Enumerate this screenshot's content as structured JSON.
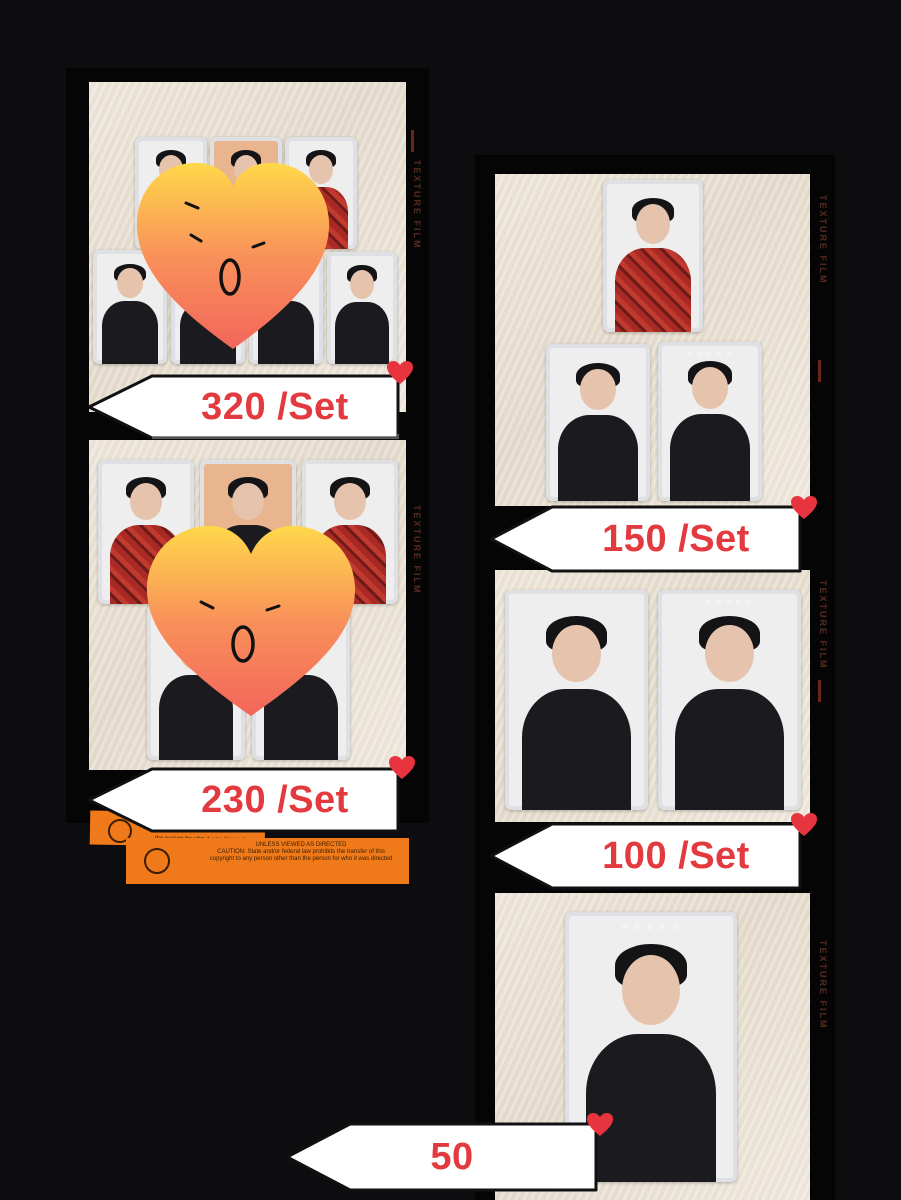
{
  "prices": {
    "set_a": "320 /Set",
    "set_b": "230 /Set",
    "set_c": "150 /Set",
    "set_d": "100 /Set",
    "single": "50"
  },
  "film_edge": {
    "brand": "TEXTURE FILM"
  },
  "sticker": {
    "line1": "the person for who it was directed",
    "line2": "UNLESS VIEWED AS DIRECTED",
    "line3": "CAUTION: State and/or federal law prohibits the transfer of this copyright to any person other than the person for who it was directed"
  },
  "icons": [
    "heart-sticker-icon",
    "small-heart-icon",
    "arrow-tag-icon",
    "smiley-icon"
  ],
  "colors": {
    "background": "#0d0d0f",
    "price_text": "#e33a3f",
    "heart_top": "#ffd84a",
    "heart_bottom": "#f2665b",
    "small_heart": "#e8343e",
    "sticker": "#f07a19"
  }
}
